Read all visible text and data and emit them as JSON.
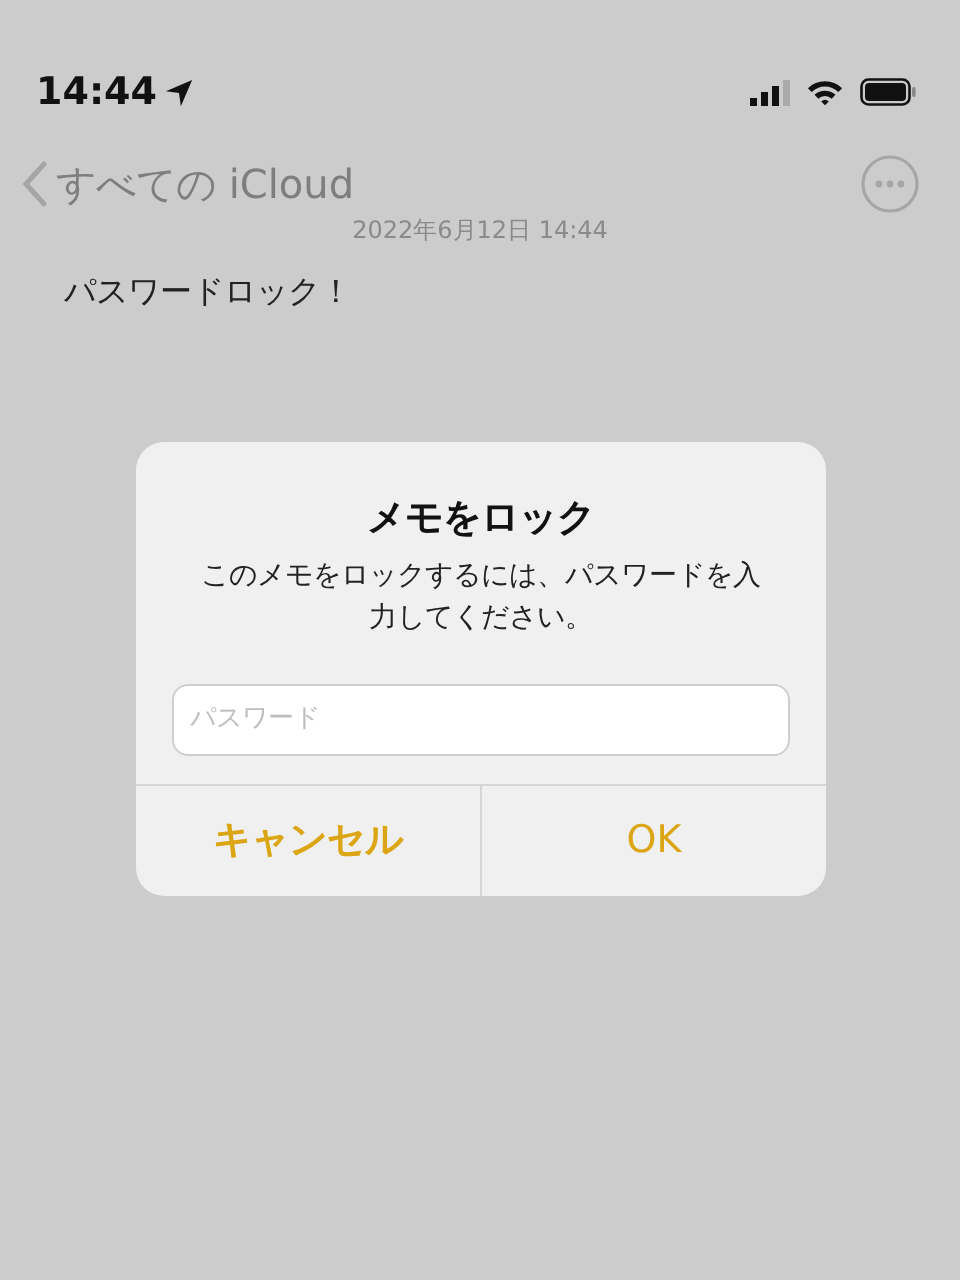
{
  "status_bar": {
    "time": "14:44"
  },
  "nav": {
    "back_label": "すべての iCloud"
  },
  "note": {
    "date": "2022年6月12日 14:44",
    "body": "パスワードロック！"
  },
  "dialog": {
    "title": "メモをロック",
    "message": "このメモをロックするには、パスワードを入力してください。",
    "field": {
      "placeholder": "パスワード"
    },
    "buttons": [
      {
        "label": "キャンセル",
        "bold": true
      },
      {
        "label": "OK",
        "bold": false
      }
    ]
  }
}
